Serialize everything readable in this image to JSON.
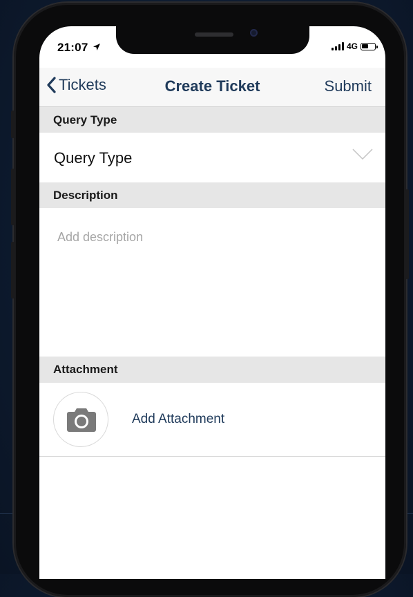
{
  "status_bar": {
    "time": "21:07",
    "network": "4G"
  },
  "navbar": {
    "back_label": "Tickets",
    "title": "Create Ticket",
    "submit_label": "Submit"
  },
  "query_type": {
    "header": "Query Type",
    "value": "Query Type"
  },
  "description": {
    "header": "Description",
    "placeholder": "Add description"
  },
  "attachment": {
    "header": "Attachment",
    "action_label": "Add Attachment"
  },
  "colors": {
    "accent": "#1f3a5a",
    "section_bg": "#e6e6e6",
    "placeholder": "#a6a6a6"
  },
  "icons": [
    "location-arrow-icon",
    "signal-bars-icon",
    "battery-icon",
    "chevron-left-icon",
    "chevron-down-icon",
    "camera-icon"
  ]
}
